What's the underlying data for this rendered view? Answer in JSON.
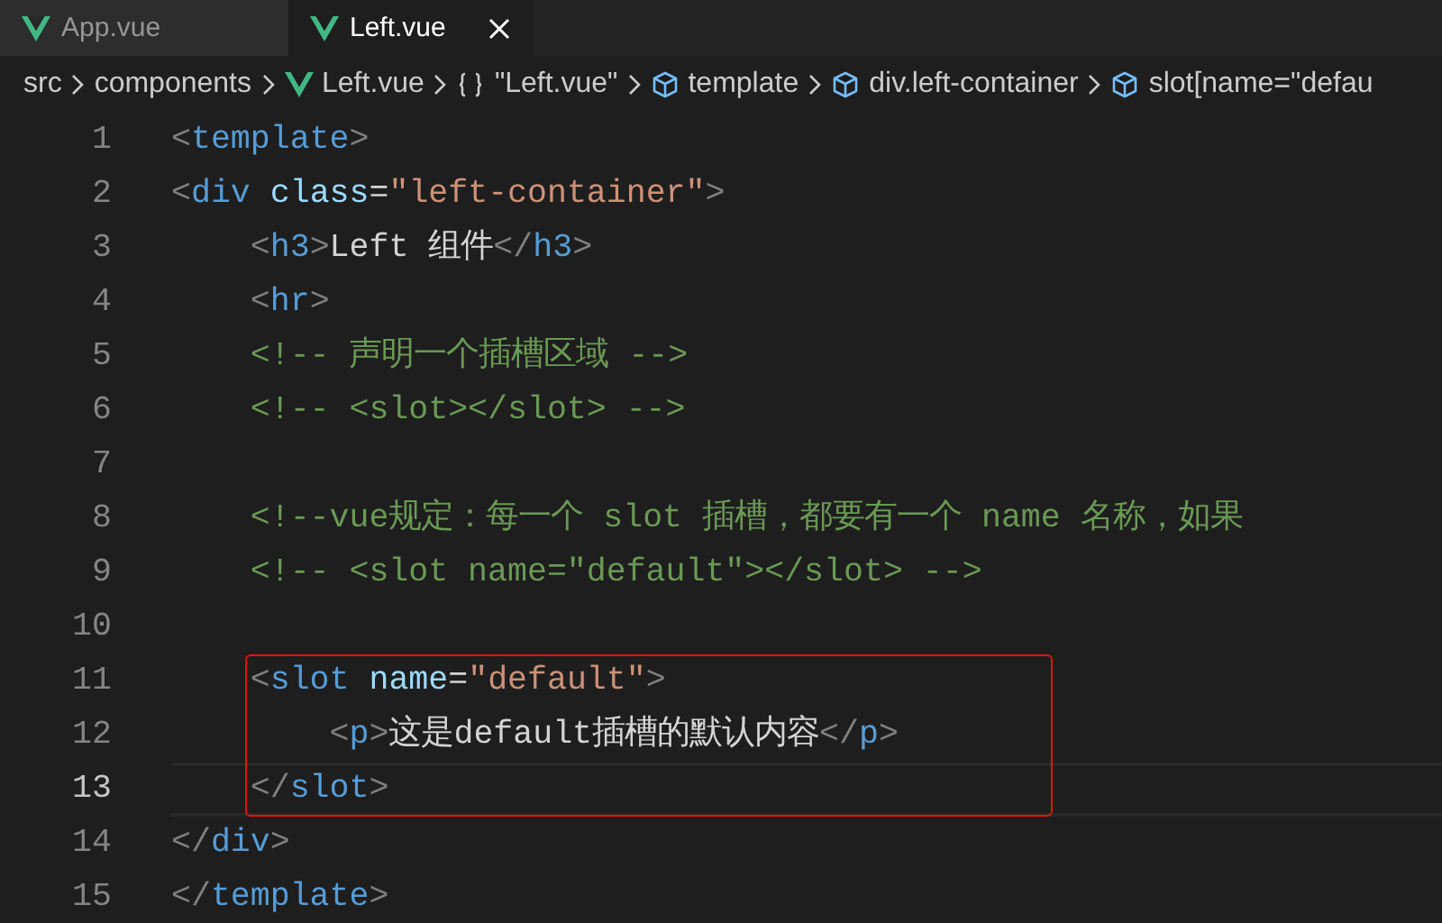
{
  "tabs": [
    {
      "label": "App.vue",
      "selected": false
    },
    {
      "label": "Left.vue",
      "selected": true
    }
  ],
  "breadcrumb": [
    {
      "label": "src",
      "kind": "folder"
    },
    {
      "label": "components",
      "kind": "folder"
    },
    {
      "label": "Left.vue",
      "kind": "file"
    },
    {
      "label": "\"Left.vue\"",
      "kind": "object"
    },
    {
      "label": "template",
      "kind": "element"
    },
    {
      "label": "div.left-container",
      "kind": "element"
    },
    {
      "label": "slot[name=\"defau",
      "kind": "element"
    }
  ],
  "editor": {
    "lines": [
      {
        "number": "1",
        "current": false,
        "boxed": false,
        "tokens": [
          {
            "kind": "punct",
            "text": "<"
          },
          {
            "kind": "tag",
            "text": "template"
          },
          {
            "kind": "punct",
            "text": ">"
          }
        ]
      },
      {
        "number": "2",
        "current": false,
        "boxed": false,
        "tokens": [
          {
            "kind": "punct",
            "text": "<"
          },
          {
            "kind": "tag",
            "text": "div"
          },
          {
            "kind": "attr",
            "text": " class"
          },
          {
            "kind": "text",
            "text": "="
          },
          {
            "kind": "string",
            "text": "\"left-container\""
          },
          {
            "kind": "punct",
            "text": ">"
          }
        ]
      },
      {
        "number": "3",
        "current": false,
        "boxed": false,
        "tokens": [
          {
            "kind": "punct",
            "text": "    <"
          },
          {
            "kind": "tag",
            "text": "h3"
          },
          {
            "kind": "punct",
            "text": ">"
          },
          {
            "kind": "text",
            "text": "Left 组件"
          },
          {
            "kind": "punct",
            "text": "</"
          },
          {
            "kind": "tag",
            "text": "h3"
          },
          {
            "kind": "punct",
            "text": ">"
          }
        ]
      },
      {
        "number": "4",
        "current": false,
        "boxed": false,
        "tokens": [
          {
            "kind": "punct",
            "text": "    <"
          },
          {
            "kind": "tag",
            "text": "hr"
          },
          {
            "kind": "punct",
            "text": ">"
          }
        ]
      },
      {
        "number": "5",
        "current": false,
        "boxed": false,
        "tokens": [
          {
            "kind": "comment",
            "text": "    <!-- 声明一个插槽区域 -->"
          }
        ]
      },
      {
        "number": "6",
        "current": false,
        "boxed": false,
        "tokens": [
          {
            "kind": "comment",
            "text": "    <!-- <slot></slot> -->"
          }
        ]
      },
      {
        "number": "7",
        "current": false,
        "boxed": false
      },
      {
        "number": "8",
        "current": false,
        "boxed": false,
        "tokens": [
          {
            "kind": "comment",
            "text": "    <!--vue规定：每一个 slot 插槽，都要有一个 name 名称，如果"
          }
        ]
      },
      {
        "number": "9",
        "current": false,
        "boxed": false,
        "tokens": [
          {
            "kind": "comment",
            "text": "    <!-- <slot name=\"default\"></slot> -->"
          }
        ]
      },
      {
        "number": "10",
        "current": false,
        "boxed": false
      },
      {
        "number": "11",
        "current": false,
        "boxed": true,
        "tokens": [
          {
            "kind": "punct",
            "text": "    <"
          },
          {
            "kind": "tag",
            "text": "slot"
          },
          {
            "kind": "attr",
            "text": " name"
          },
          {
            "kind": "text",
            "text": "="
          },
          {
            "kind": "string",
            "text": "\"default\""
          },
          {
            "kind": "punct",
            "text": ">"
          }
        ]
      },
      {
        "number": "12",
        "current": false,
        "boxed": true,
        "tokens": [
          {
            "kind": "punct",
            "text": "        <"
          },
          {
            "kind": "tag",
            "text": "p"
          },
          {
            "kind": "punct",
            "text": ">"
          },
          {
            "kind": "text",
            "text": "这是default插槽的默认内容"
          },
          {
            "kind": "punct",
            "text": "</"
          },
          {
            "kind": "tag",
            "text": "p"
          },
          {
            "kind": "punct",
            "text": ">"
          }
        ]
      },
      {
        "number": "13",
        "current": true,
        "boxed": true,
        "tokens": [
          {
            "kind": "punct",
            "text": "    </"
          },
          {
            "kind": "tag",
            "text": "slot"
          },
          {
            "kind": "punct",
            "text": ">"
          }
        ]
      },
      {
        "number": "14",
        "current": false,
        "boxed": false,
        "tokens": [
          {
            "kind": "punct",
            "text": "</"
          },
          {
            "kind": "tag",
            "text": "div"
          },
          {
            "kind": "punct",
            "text": ">"
          }
        ]
      },
      {
        "number": "15",
        "current": false,
        "boxed": false,
        "tokens": [
          {
            "kind": "punct",
            "text": "</"
          },
          {
            "kind": "tag",
            "text": "template"
          },
          {
            "kind": "punct",
            "text": ">"
          }
        ]
      }
    ]
  }
}
